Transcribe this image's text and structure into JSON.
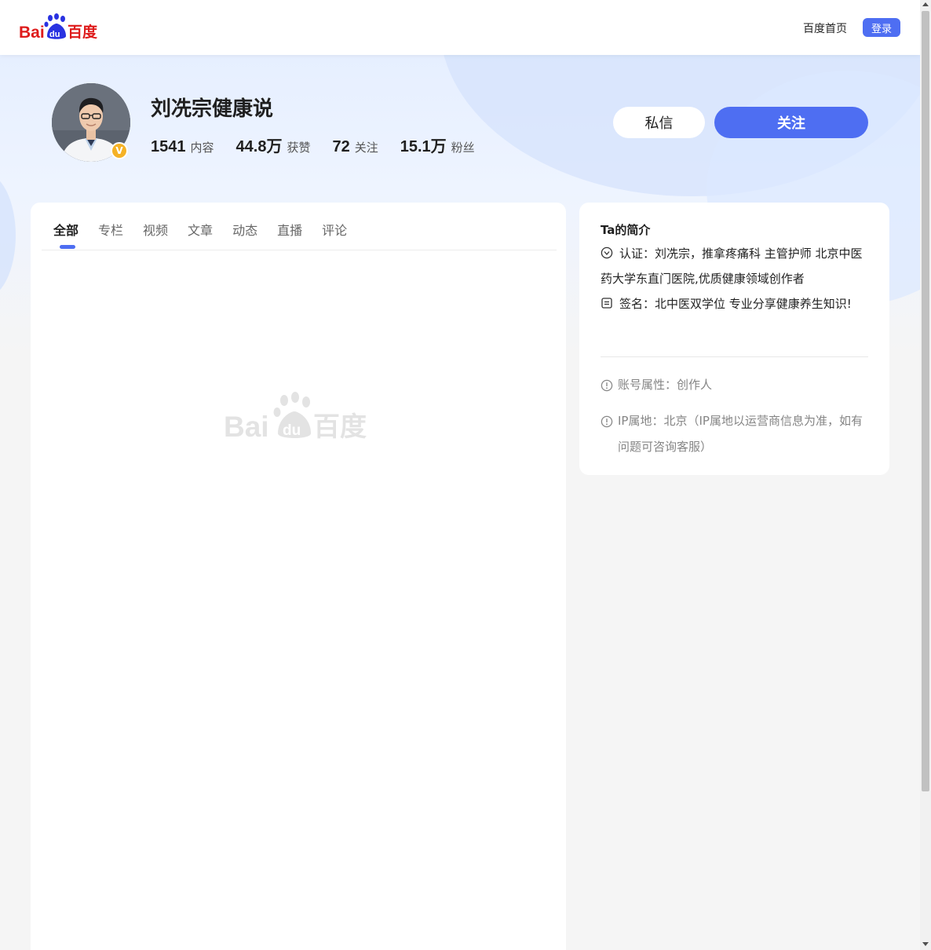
{
  "header": {
    "logo_text_bai": "Bai",
    "logo_text_du": "du",
    "logo_text_cn": "百度",
    "home_link": "百度首页",
    "login_label": "登录"
  },
  "profile": {
    "name": "刘冼宗健康说",
    "badge": "V",
    "stats": [
      {
        "value": "1541",
        "label": "内容"
      },
      {
        "value": "44.8万",
        "label": "获赞"
      },
      {
        "value": "72",
        "label": "关注"
      },
      {
        "value": "15.1万",
        "label": "粉丝"
      }
    ],
    "message_label": "私信",
    "follow_label": "关注"
  },
  "tabs": [
    {
      "label": "全部",
      "active": true
    },
    {
      "label": "专栏",
      "active": false
    },
    {
      "label": "视频",
      "active": false
    },
    {
      "label": "文章",
      "active": false
    },
    {
      "label": "动态",
      "active": false
    },
    {
      "label": "直播",
      "active": false
    },
    {
      "label": "评论",
      "active": false
    }
  ],
  "intro": {
    "title": "Ta的简介",
    "certification": "认证：刘冼宗，推拿疼痛科 主管护师 北京中医药大学东直门医院,优质健康领域创作者",
    "signature": "签名：北中医双学位 专业分享健康养生知识!",
    "account_type": "账号属性：创作人",
    "ip_location": "IP属地：北京（IP属地以运营商信息为准，如有问题可咨询客服）"
  },
  "colors": {
    "accent": "#4e6ef2",
    "logo_red": "#de1b1b",
    "logo_blue": "#2932e1",
    "badge_gold": "#f5b226"
  }
}
